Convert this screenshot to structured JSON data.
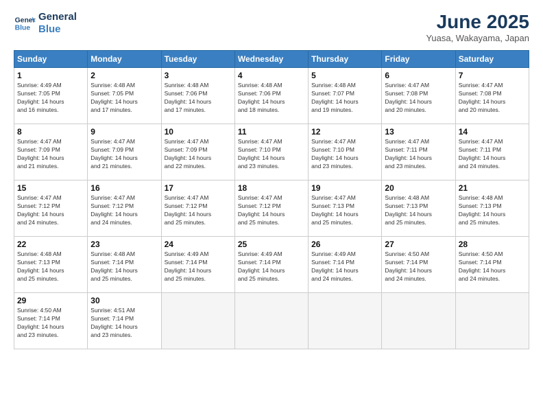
{
  "header": {
    "logo_line1": "General",
    "logo_line2": "Blue",
    "month_title": "June 2025",
    "location": "Yuasa, Wakayama, Japan"
  },
  "weekdays": [
    "Sunday",
    "Monday",
    "Tuesday",
    "Wednesday",
    "Thursday",
    "Friday",
    "Saturday"
  ],
  "weeks": [
    [
      {
        "day": "1",
        "info": "Sunrise: 4:49 AM\nSunset: 7:05 PM\nDaylight: 14 hours\nand 16 minutes."
      },
      {
        "day": "2",
        "info": "Sunrise: 4:48 AM\nSunset: 7:05 PM\nDaylight: 14 hours\nand 17 minutes."
      },
      {
        "day": "3",
        "info": "Sunrise: 4:48 AM\nSunset: 7:06 PM\nDaylight: 14 hours\nand 17 minutes."
      },
      {
        "day": "4",
        "info": "Sunrise: 4:48 AM\nSunset: 7:06 PM\nDaylight: 14 hours\nand 18 minutes."
      },
      {
        "day": "5",
        "info": "Sunrise: 4:48 AM\nSunset: 7:07 PM\nDaylight: 14 hours\nand 19 minutes."
      },
      {
        "day": "6",
        "info": "Sunrise: 4:47 AM\nSunset: 7:08 PM\nDaylight: 14 hours\nand 20 minutes."
      },
      {
        "day": "7",
        "info": "Sunrise: 4:47 AM\nSunset: 7:08 PM\nDaylight: 14 hours\nand 20 minutes."
      }
    ],
    [
      {
        "day": "8",
        "info": "Sunrise: 4:47 AM\nSunset: 7:09 PM\nDaylight: 14 hours\nand 21 minutes."
      },
      {
        "day": "9",
        "info": "Sunrise: 4:47 AM\nSunset: 7:09 PM\nDaylight: 14 hours\nand 21 minutes."
      },
      {
        "day": "10",
        "info": "Sunrise: 4:47 AM\nSunset: 7:09 PM\nDaylight: 14 hours\nand 22 minutes."
      },
      {
        "day": "11",
        "info": "Sunrise: 4:47 AM\nSunset: 7:10 PM\nDaylight: 14 hours\nand 23 minutes."
      },
      {
        "day": "12",
        "info": "Sunrise: 4:47 AM\nSunset: 7:10 PM\nDaylight: 14 hours\nand 23 minutes."
      },
      {
        "day": "13",
        "info": "Sunrise: 4:47 AM\nSunset: 7:11 PM\nDaylight: 14 hours\nand 23 minutes."
      },
      {
        "day": "14",
        "info": "Sunrise: 4:47 AM\nSunset: 7:11 PM\nDaylight: 14 hours\nand 24 minutes."
      }
    ],
    [
      {
        "day": "15",
        "info": "Sunrise: 4:47 AM\nSunset: 7:12 PM\nDaylight: 14 hours\nand 24 minutes."
      },
      {
        "day": "16",
        "info": "Sunrise: 4:47 AM\nSunset: 7:12 PM\nDaylight: 14 hours\nand 24 minutes."
      },
      {
        "day": "17",
        "info": "Sunrise: 4:47 AM\nSunset: 7:12 PM\nDaylight: 14 hours\nand 25 minutes."
      },
      {
        "day": "18",
        "info": "Sunrise: 4:47 AM\nSunset: 7:12 PM\nDaylight: 14 hours\nand 25 minutes."
      },
      {
        "day": "19",
        "info": "Sunrise: 4:47 AM\nSunset: 7:13 PM\nDaylight: 14 hours\nand 25 minutes."
      },
      {
        "day": "20",
        "info": "Sunrise: 4:48 AM\nSunset: 7:13 PM\nDaylight: 14 hours\nand 25 minutes."
      },
      {
        "day": "21",
        "info": "Sunrise: 4:48 AM\nSunset: 7:13 PM\nDaylight: 14 hours\nand 25 minutes."
      }
    ],
    [
      {
        "day": "22",
        "info": "Sunrise: 4:48 AM\nSunset: 7:13 PM\nDaylight: 14 hours\nand 25 minutes."
      },
      {
        "day": "23",
        "info": "Sunrise: 4:48 AM\nSunset: 7:14 PM\nDaylight: 14 hours\nand 25 minutes."
      },
      {
        "day": "24",
        "info": "Sunrise: 4:49 AM\nSunset: 7:14 PM\nDaylight: 14 hours\nand 25 minutes."
      },
      {
        "day": "25",
        "info": "Sunrise: 4:49 AM\nSunset: 7:14 PM\nDaylight: 14 hours\nand 25 minutes."
      },
      {
        "day": "26",
        "info": "Sunrise: 4:49 AM\nSunset: 7:14 PM\nDaylight: 14 hours\nand 24 minutes."
      },
      {
        "day": "27",
        "info": "Sunrise: 4:50 AM\nSunset: 7:14 PM\nDaylight: 14 hours\nand 24 minutes."
      },
      {
        "day": "28",
        "info": "Sunrise: 4:50 AM\nSunset: 7:14 PM\nDaylight: 14 hours\nand 24 minutes."
      }
    ],
    [
      {
        "day": "29",
        "info": "Sunrise: 4:50 AM\nSunset: 7:14 PM\nDaylight: 14 hours\nand 23 minutes."
      },
      {
        "day": "30",
        "info": "Sunrise: 4:51 AM\nSunset: 7:14 PM\nDaylight: 14 hours\nand 23 minutes."
      },
      null,
      null,
      null,
      null,
      null
    ]
  ]
}
